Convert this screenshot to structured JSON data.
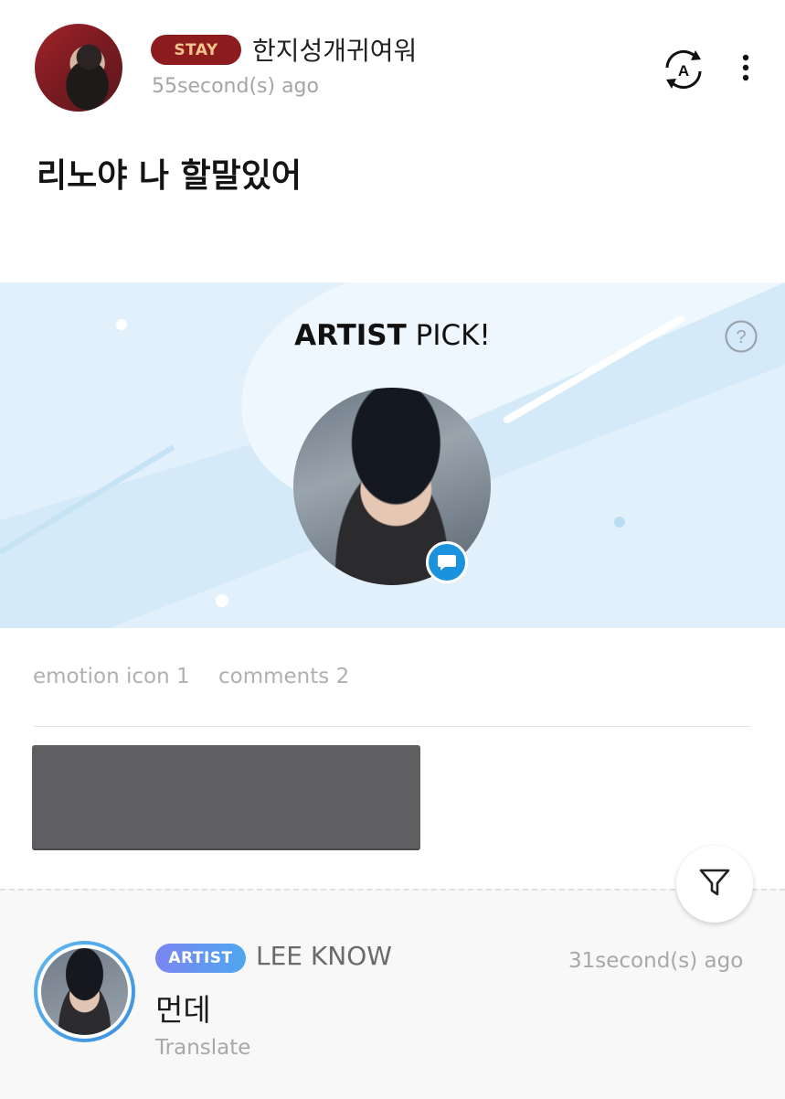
{
  "post": {
    "badge": "STAY",
    "username": "한지성개귀여워",
    "time": "55second(s) ago",
    "text": "리노야 나 할말있어",
    "icons": {
      "translate": "translate-icon",
      "more": "more-vertical-icon"
    }
  },
  "banner": {
    "title_bold": "ARTIST",
    "title_rest": " PICK!",
    "help_icon": "help-icon",
    "chat_icon": "chat-bubble-icon",
    "colors": {
      "background": "#e2f0fb",
      "highlight": "#b5dbf4",
      "chat_badge": "#1a92de"
    }
  },
  "stats": {
    "emotion": "emotion icon 1",
    "comments": "comments 2"
  },
  "comment": {
    "badge": "ARTIST",
    "name": "LEE KNOW",
    "time": "31second(s) ago",
    "text": "먼데",
    "translate": "Translate",
    "filter_icon": "filter-icon"
  },
  "colors": {
    "stay_badge": "#8c1c1d",
    "stay_text": "#f2c38d",
    "artist_badge_start": "#7a86f2",
    "artist_badge_end": "#4fa6ef"
  }
}
